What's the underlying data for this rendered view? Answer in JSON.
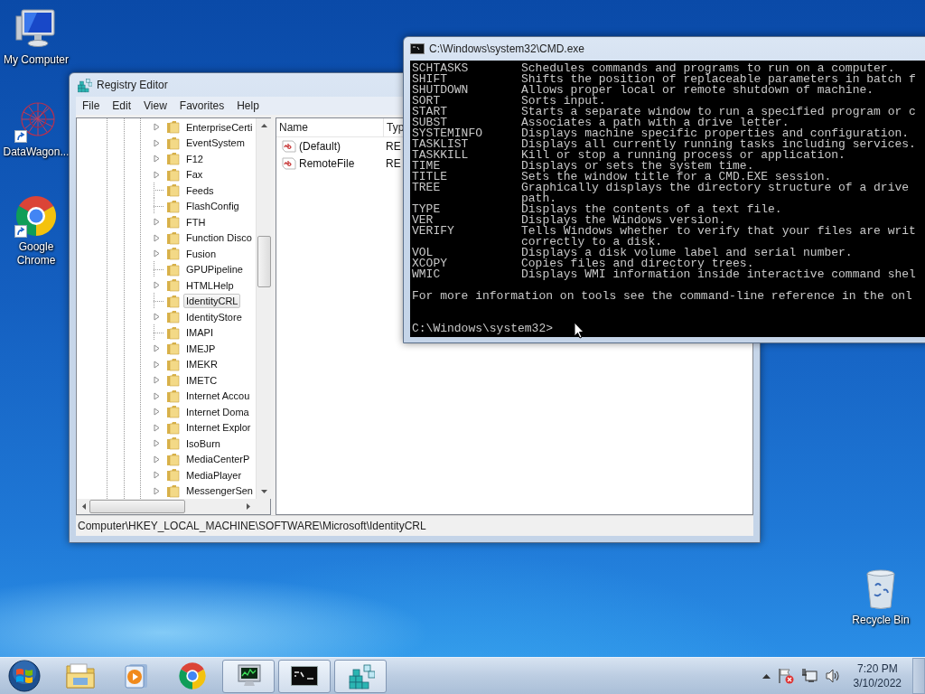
{
  "desktop_icons": [
    {
      "kind": "computer",
      "label": "My Computer",
      "shortcut": false
    },
    {
      "kind": "network-graph",
      "label": "DataWagon...",
      "shortcut": true
    },
    {
      "kind": "browser",
      "label": "Google Chrome",
      "shortcut": true
    },
    {
      "kind": "recycle-bin",
      "label": "Recycle Bin",
      "shortcut": false
    }
  ],
  "registry_editor": {
    "title": "Registry Editor",
    "menu": [
      "File",
      "Edit",
      "View",
      "Favorites",
      "Help"
    ],
    "tree": [
      {
        "label": "EnterpriseCerti",
        "expandable": true,
        "selected": false
      },
      {
        "label": "EventSystem",
        "expandable": true,
        "selected": false
      },
      {
        "label": "F12",
        "expandable": true,
        "selected": false
      },
      {
        "label": "Fax",
        "expandable": true,
        "selected": false
      },
      {
        "label": "Feeds",
        "expandable": false,
        "selected": false
      },
      {
        "label": "FlashConfig",
        "expandable": false,
        "selected": false
      },
      {
        "label": "FTH",
        "expandable": true,
        "selected": false
      },
      {
        "label": "Function Disco",
        "expandable": true,
        "selected": false
      },
      {
        "label": "Fusion",
        "expandable": true,
        "selected": false
      },
      {
        "label": "GPUPipeline",
        "expandable": false,
        "selected": false
      },
      {
        "label": "HTMLHelp",
        "expandable": true,
        "selected": false
      },
      {
        "label": "IdentityCRL",
        "expandable": false,
        "selected": true
      },
      {
        "label": "IdentityStore",
        "expandable": true,
        "selected": false
      },
      {
        "label": "IMAPI",
        "expandable": false,
        "selected": false
      },
      {
        "label": "IMEJP",
        "expandable": true,
        "selected": false
      },
      {
        "label": "IMEKR",
        "expandable": true,
        "selected": false
      },
      {
        "label": "IMETC",
        "expandable": true,
        "selected": false
      },
      {
        "label": "Internet Accou",
        "expandable": true,
        "selected": false
      },
      {
        "label": "Internet Doma",
        "expandable": true,
        "selected": false
      },
      {
        "label": "Internet Explor",
        "expandable": true,
        "selected": false
      },
      {
        "label": "IsoBurn",
        "expandable": true,
        "selected": false
      },
      {
        "label": "MediaCenterP",
        "expandable": true,
        "selected": false
      },
      {
        "label": "MediaPlayer",
        "expandable": true,
        "selected": false
      },
      {
        "label": "MessengerSen",
        "expandable": true,
        "selected": false
      }
    ],
    "columns": [
      "Name",
      "Typ"
    ],
    "values": [
      {
        "name": "(Default)",
        "type": "RE"
      },
      {
        "name": "RemoteFile",
        "type": "RE"
      }
    ],
    "status_bar": "Computer\\HKEY_LOCAL_MACHINE\\SOFTWARE\\Microsoft\\IdentityCRL"
  },
  "cmd": {
    "title": "C:\\Windows\\system32\\CMD.exe",
    "lines": [
      {
        "command": "SCHTASKS",
        "description": "Schedules commands and programs to run on a computer."
      },
      {
        "command": "SHIFT",
        "description": "Shifts the position of replaceable parameters in batch f"
      },
      {
        "command": "SHUTDOWN",
        "description": "Allows proper local or remote shutdown of machine."
      },
      {
        "command": "SORT",
        "description": "Sorts input."
      },
      {
        "command": "START",
        "description": "Starts a separate window to run a specified program or c"
      },
      {
        "command": "SUBST",
        "description": "Associates a path with a drive letter."
      },
      {
        "command": "SYSTEMINFO",
        "description": "Displays machine specific properties and configuration."
      },
      {
        "command": "TASKLIST",
        "description": "Displays all currently running tasks including services."
      },
      {
        "command": "TASKKILL",
        "description": "Kill or stop a running process or application."
      },
      {
        "command": "TIME",
        "description": "Displays or sets the system time."
      },
      {
        "command": "TITLE",
        "description": "Sets the window title for a CMD.EXE session."
      },
      {
        "command": "TREE",
        "description": "Graphically displays the directory structure of a drive"
      },
      {
        "description": "path."
      },
      {
        "command": "TYPE",
        "description": "Displays the contents of a text file."
      },
      {
        "command": "VER",
        "description": "Displays the Windows version."
      },
      {
        "command": "VERIFY",
        "description": "Tells Windows whether to verify that your files are writ"
      },
      {
        "description": "correctly to a disk."
      },
      {
        "command": "VOL",
        "description": "Displays a disk volume label and serial number."
      },
      {
        "command": "XCOPY",
        "description": "Copies files and directory trees."
      },
      {
        "command": "WMIC",
        "description": "Displays WMI information inside interactive command shel"
      }
    ],
    "footer": "For more information on tools see the command-line reference in the onl",
    "prompt": "C:\\Windows\\system32>"
  },
  "taskbar": {
    "items": [
      {
        "kind": "explorer",
        "open": false
      },
      {
        "kind": "media-player",
        "open": false
      },
      {
        "kind": "browser",
        "open": false
      },
      {
        "kind": "monitor",
        "open": true
      },
      {
        "kind": "terminal",
        "open": true
      },
      {
        "kind": "registry",
        "open": true
      }
    ],
    "time": "7:20 PM",
    "date": "3/10/2022"
  }
}
